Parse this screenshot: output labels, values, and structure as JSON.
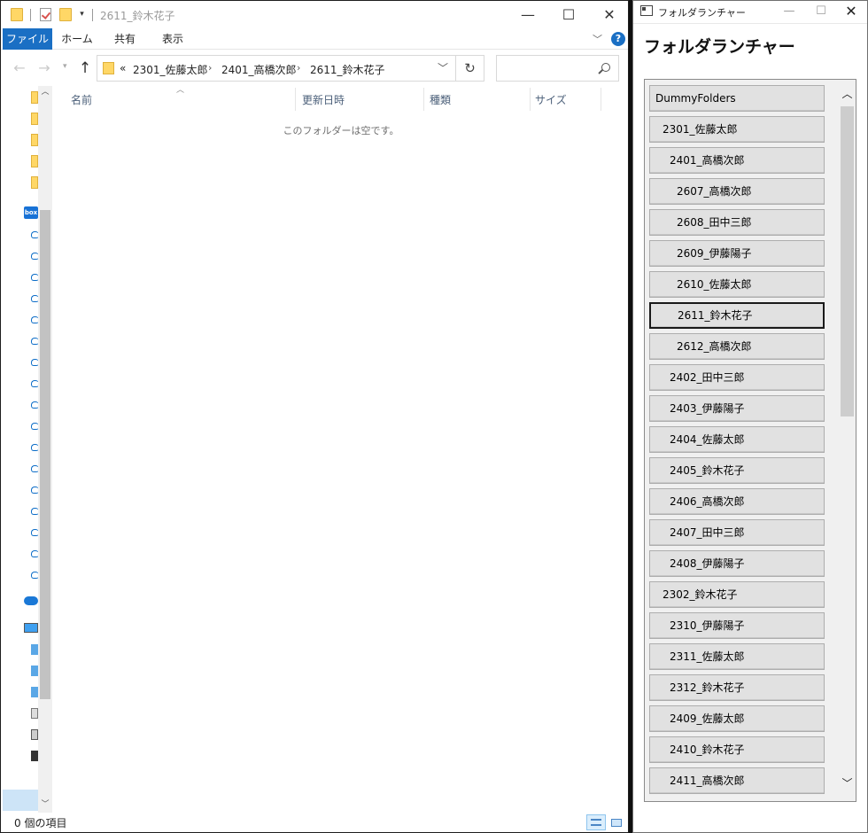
{
  "explorer": {
    "window_title": "2611_鈴木花子",
    "ribbon_tabs": [
      "ファイル",
      "ホーム",
      "共有",
      "表示"
    ],
    "breadcrumb": {
      "overflow": "«",
      "items": [
        "2301_佐藤太郎",
        "2401_高橋次郎",
        "2611_鈴木花子"
      ]
    },
    "search": {
      "placeholder": ""
    },
    "columns": [
      "名前",
      "更新日時",
      "種類",
      "サイズ"
    ],
    "empty_message": "このフォルダーは空です。",
    "status": "0 個の項目"
  },
  "launcher": {
    "window_title": "フォルダランチャー",
    "heading": "フォルダランチャー",
    "buttons": [
      {
        "label": "DummyFolders",
        "level": 0
      },
      {
        "label": "2301_佐藤太郎",
        "level": 1
      },
      {
        "label": "2401_高橋次郎",
        "level": 2
      },
      {
        "label": "2607_高橋次郎",
        "level": 3
      },
      {
        "label": "2608_田中三郎",
        "level": 3
      },
      {
        "label": "2609_伊藤陽子",
        "level": 3
      },
      {
        "label": "2610_佐藤太郎",
        "level": 3
      },
      {
        "label": "2611_鈴木花子",
        "level": 3,
        "selected": true
      },
      {
        "label": "2612_高橋次郎",
        "level": 3
      },
      {
        "label": "2402_田中三郎",
        "level": 2
      },
      {
        "label": "2403_伊藤陽子",
        "level": 2
      },
      {
        "label": "2404_佐藤太郎",
        "level": 2
      },
      {
        "label": "2405_鈴木花子",
        "level": 2
      },
      {
        "label": "2406_高橋次郎",
        "level": 2
      },
      {
        "label": "2407_田中三郎",
        "level": 2
      },
      {
        "label": "2408_伊藤陽子",
        "level": 2
      },
      {
        "label": "2302_鈴木花子",
        "level": 1
      },
      {
        "label": "2310_伊藤陽子",
        "level": 2
      },
      {
        "label": "2311_佐藤太郎",
        "level": 2
      },
      {
        "label": "2312_鈴木花子",
        "level": 2
      },
      {
        "label": "2409_佐藤太郎",
        "level": 2
      },
      {
        "label": "2410_鈴木花子",
        "level": 2
      },
      {
        "label": "2411_高橋次郎",
        "level": 2
      }
    ]
  },
  "colors": {
    "file_tab": "#1a6fc4",
    "folder_yellow": "#ffd766",
    "button_face": "#e1e1e1"
  }
}
